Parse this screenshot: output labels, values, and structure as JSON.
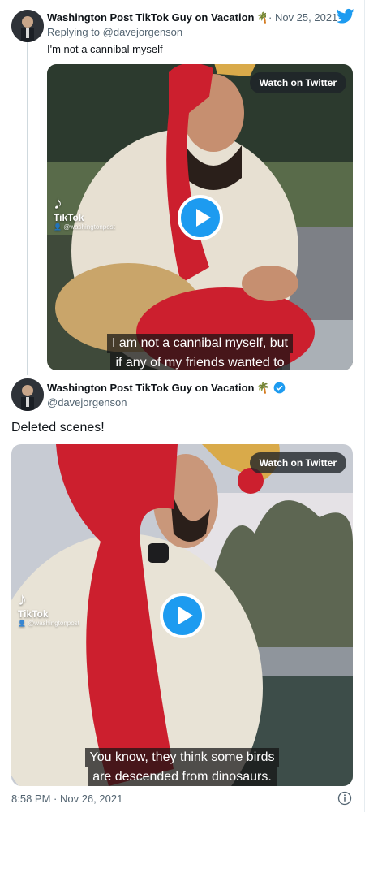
{
  "reply_tweet": {
    "author_name": "Washington Post TikTok Guy on Vacation",
    "author_emoji": "🌴",
    "date": "Nov 25, 2021",
    "replying_to": "Replying to @davejorgenson",
    "text": "I'm not a cannibal myself",
    "media": {
      "watch_label": "Watch on Twitter",
      "tiktok_word": "TikTok",
      "tiktok_user": "@washingtonpost",
      "caption_line1": "I am not a cannibal myself, but",
      "caption_line2": "if any of my friends wanted to"
    }
  },
  "main_tweet": {
    "author_name": "Washington Post TikTok Guy on Vacation",
    "author_emoji": "🌴",
    "handle": "@davejorgenson",
    "text": "Deleted scenes!",
    "media": {
      "watch_label": "Watch on Twitter",
      "tiktok_word": "TikTok",
      "tiktok_user": "@washingtonpost",
      "caption_line1": "You know, they think some birds",
      "caption_line2": "are descended from dinosaurs."
    },
    "timestamp": "8:58 PM · Nov 26, 2021"
  },
  "colors": {
    "accent": "#1d9bf0",
    "muted": "#536471",
    "text": "#0f1419"
  },
  "icons": [
    "twitter-bird-icon",
    "verified-badge-icon",
    "play-icon",
    "info-icon",
    "tiktok-logo-icon"
  ]
}
